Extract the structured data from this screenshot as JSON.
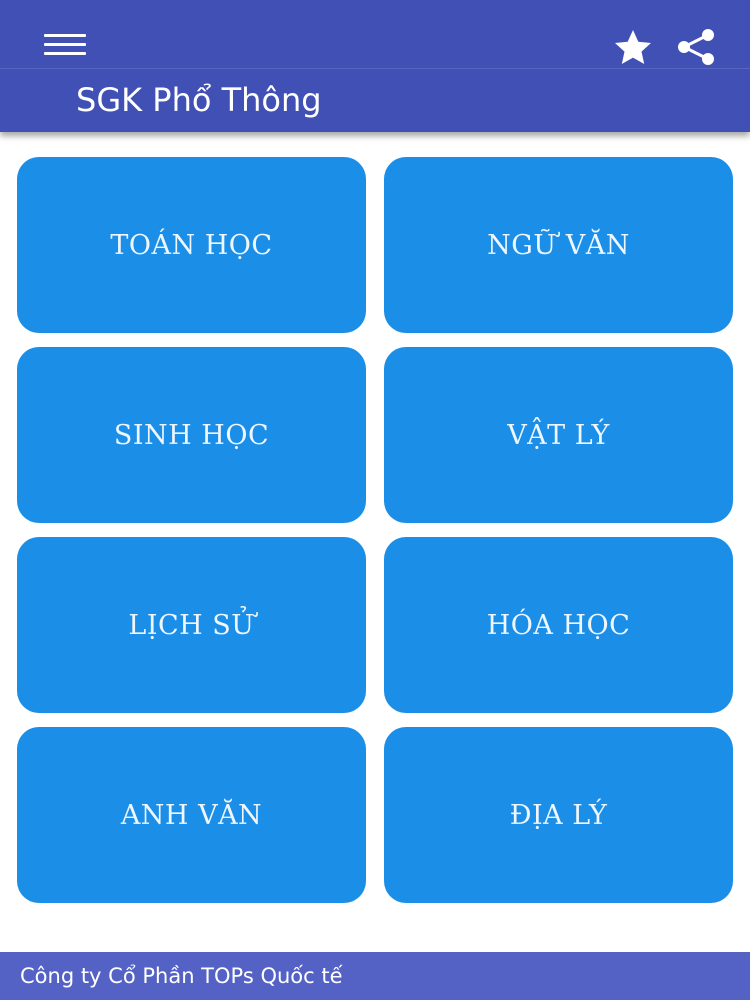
{
  "app_bar": {
    "title": "SGK Phổ Thông",
    "background_color": "#4150b5",
    "menu_icon": "hamburger-menu-icon",
    "favorite_icon": "star-icon",
    "share_icon": "share-icon"
  },
  "subjects": [
    {
      "label": "TOÁN HỌC"
    },
    {
      "label": "NGỮ VĂN"
    },
    {
      "label": "SINH HỌC"
    },
    {
      "label": "VẬT LÝ"
    },
    {
      "label": "LỊCH SỬ"
    },
    {
      "label": "HÓA HỌC"
    },
    {
      "label": "ANH VĂN"
    },
    {
      "label": "ĐỊA LÝ"
    }
  ],
  "subject_button_color": "#1b8fe8",
  "footer": {
    "text": "Công ty Cổ Phần TOPs Quốc tế",
    "background_color": "#5562c5"
  }
}
